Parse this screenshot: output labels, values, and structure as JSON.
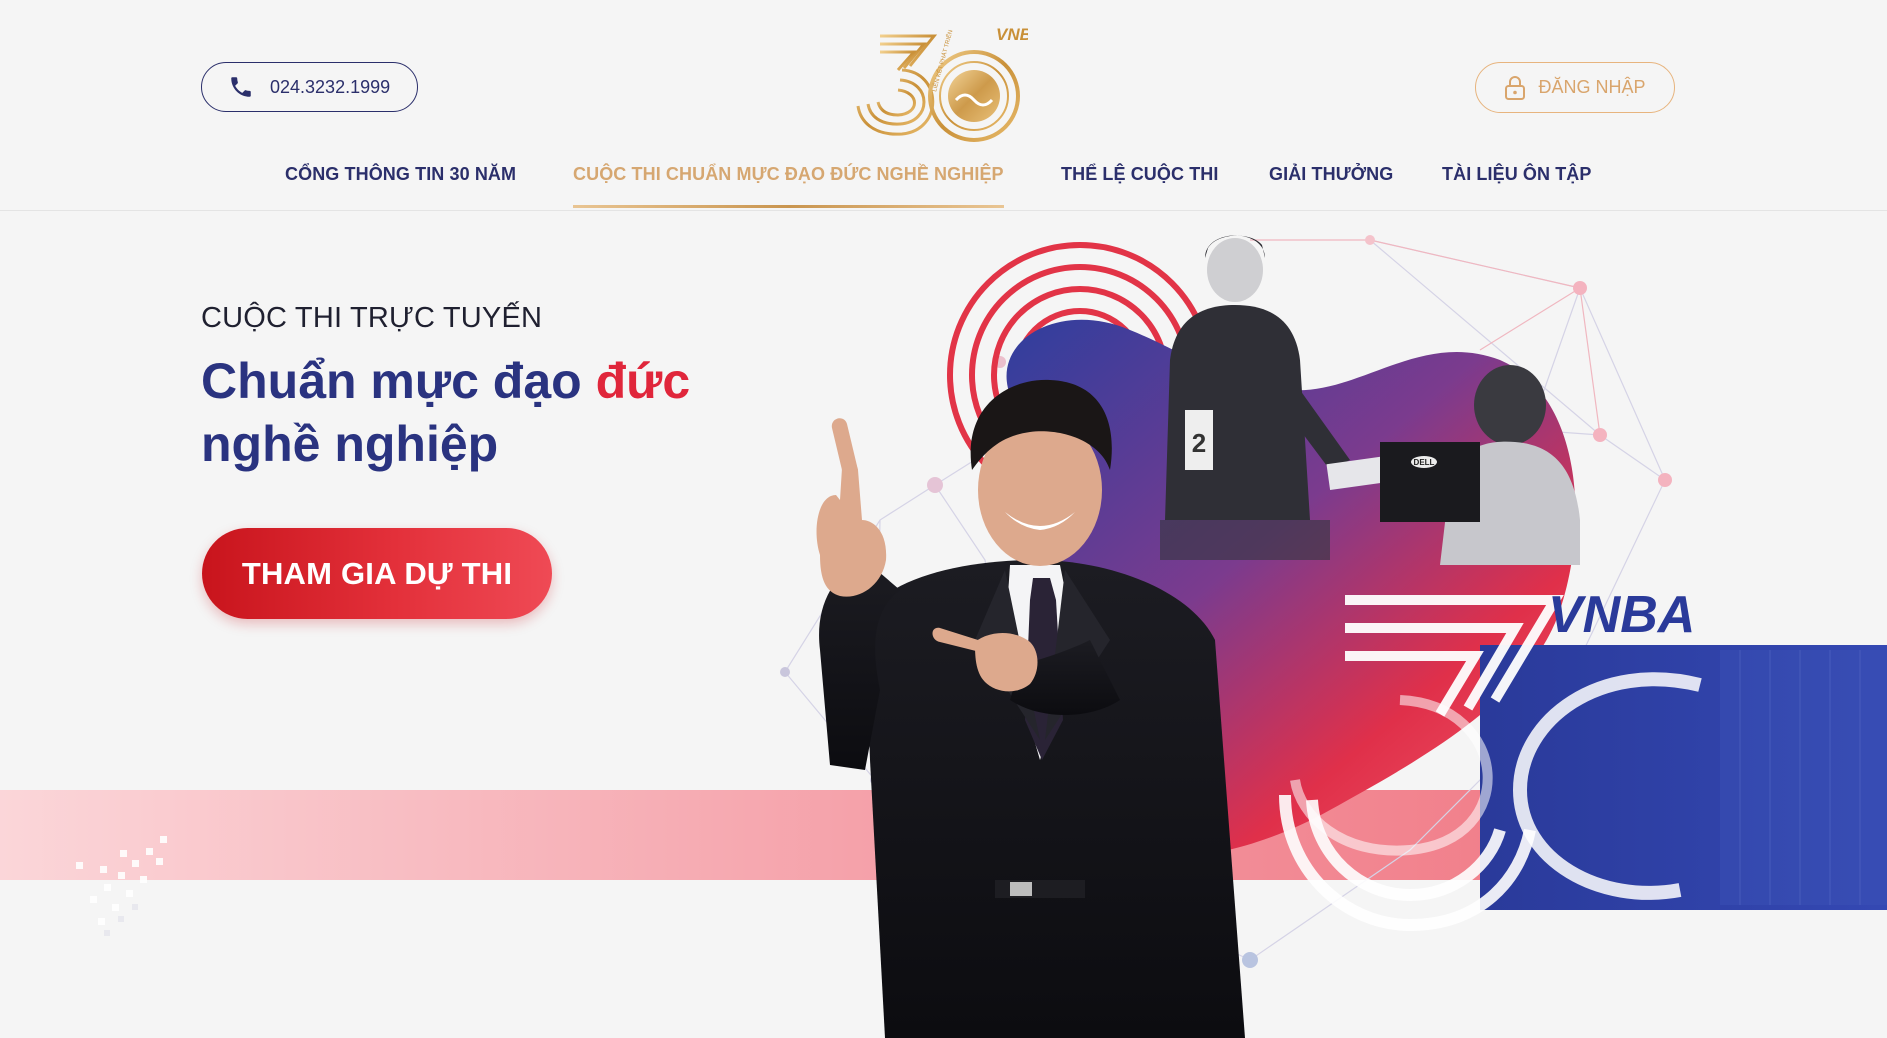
{
  "header": {
    "phone": "024.3232.1999",
    "login_label": "ĐĂNG NHẬP",
    "logo": {
      "number": "30",
      "brand": "VNBA",
      "ring_text": "LIÊN KẾT PHÁT TRIỂN"
    }
  },
  "nav": {
    "items": [
      {
        "label": "CỔNG THÔNG TIN 30 NĂM"
      },
      {
        "label": "CUỘC THI CHUẨN MỰC ĐẠO ĐỨC NGHỀ NGHIỆP"
      },
      {
        "label": "THỂ LỆ CUỘC THI"
      },
      {
        "label": "GIẢI THƯỞNG"
      },
      {
        "label": "TÀI LIỆU ÔN TẬP"
      }
    ]
  },
  "hero": {
    "eyebrow": "CUỘC THI TRỰC TUYẾN",
    "headline_part1": "Chuẩn mực đạo ",
    "headline_part2": "đức",
    "headline_part3": "nghề nghiệp",
    "cta": "THAM GIA DỰ THI",
    "badge_brand": "VNBA",
    "counter_number": "2",
    "monitor_brand": "DELL"
  },
  "colors": {
    "navy": "#2b2f6b",
    "gold": "#d6a771",
    "red": "#e0263b",
    "blue": "#2d3a9c"
  },
  "icons": {
    "phone": "phone-icon",
    "lock": "lock-icon"
  }
}
